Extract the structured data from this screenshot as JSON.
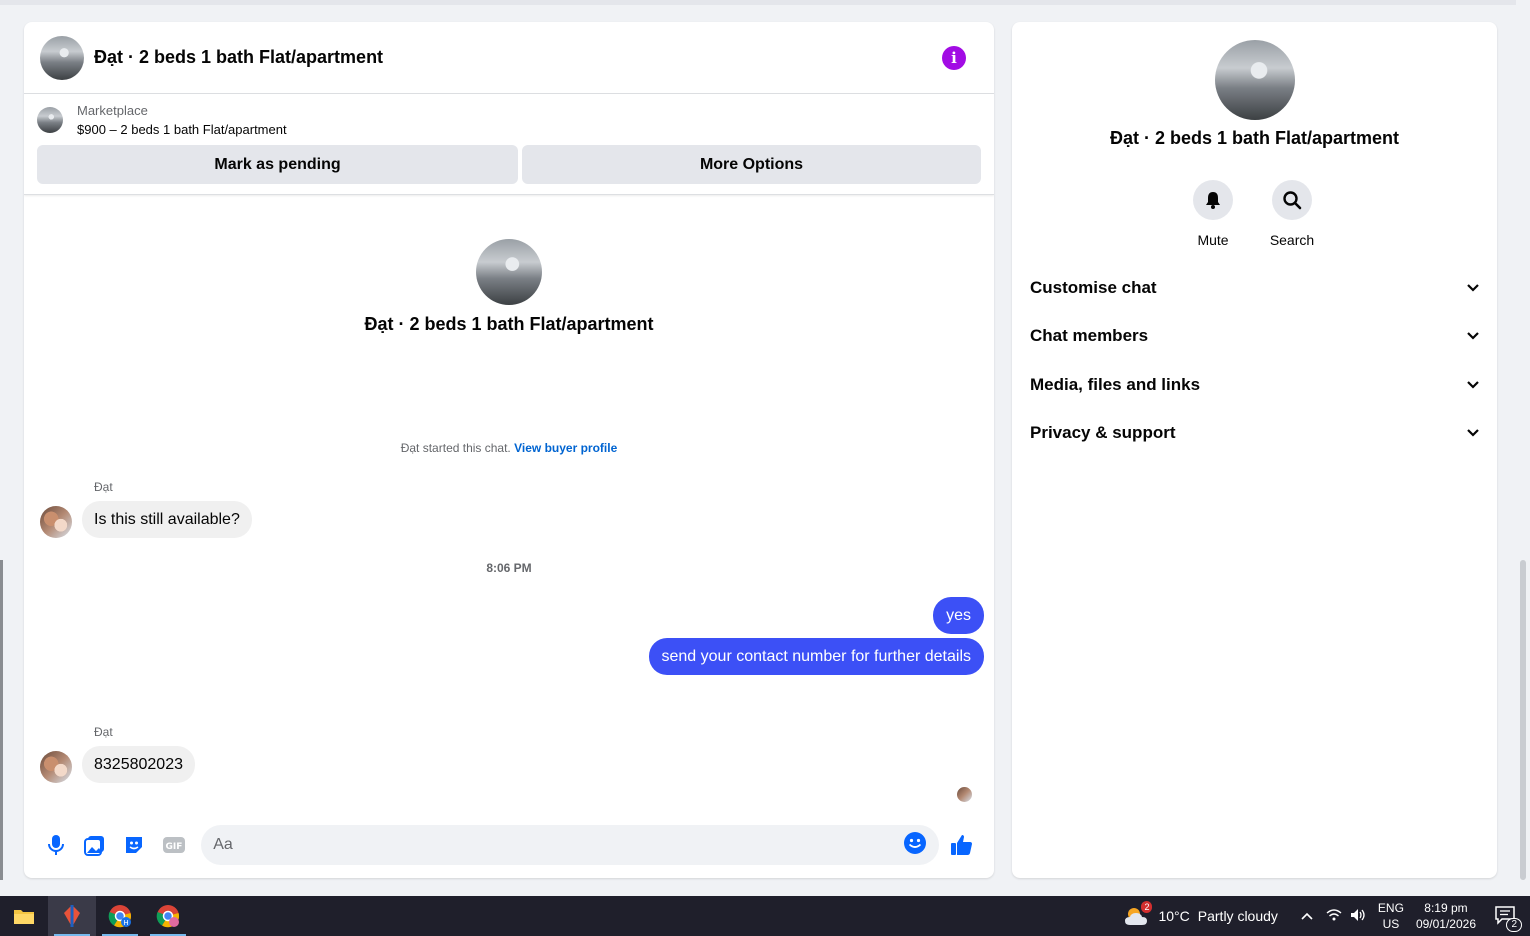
{
  "header": {
    "title": "Đạt · 2 beds 1 bath Flat/apartment",
    "info_icon": "info-icon"
  },
  "marketplace": {
    "label": "Marketplace",
    "item": "$900 – 2 beds 1 bath Flat/apartment",
    "pending_label": "Mark as pending",
    "more_label": "More Options"
  },
  "thread": {
    "intro_title": "Đạt · 2 beds 1 bath Flat/apartment",
    "started_text": "Đạt started this chat.",
    "buyer_link": "View buyer profile",
    "messages": [
      {
        "sender": "Đạt",
        "text": "Is this still available?",
        "direction": "in"
      },
      {
        "text": "yes",
        "direction": "out"
      },
      {
        "text": "send your contact number for further details",
        "direction": "out"
      },
      {
        "sender": "Đạt",
        "text": "8325802023",
        "direction": "in"
      }
    ],
    "timestamp": "8:06 PM"
  },
  "composer": {
    "placeholder": "Aa"
  },
  "side": {
    "title": "Đạt · 2 beds 1 bath Flat/apartment",
    "mute_label": "Mute",
    "search_label": "Search",
    "rows": [
      "Customise chat",
      "Chat members",
      "Media, files and links",
      "Privacy & support"
    ]
  },
  "taskbar": {
    "weather_temp": "10°C",
    "weather_desc": "Partly cloudy",
    "weather_badge": "2",
    "lang_top": "ENG",
    "lang_bottom": "US",
    "time": "8:19 pm",
    "date": "09/01/2026",
    "notif_count": "2"
  },
  "colors": {
    "accent": "#3c50f6",
    "info": "#a20ce4",
    "link": "#0064d1",
    "composer_icon": "#0866ff"
  }
}
